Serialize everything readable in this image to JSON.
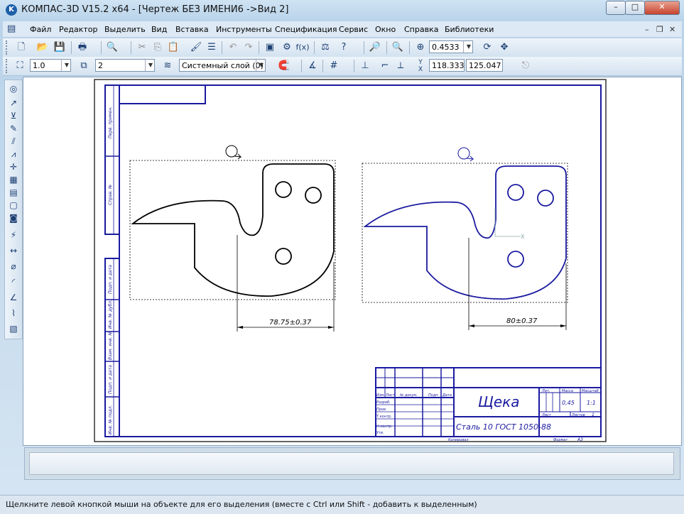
{
  "window": {
    "title": "КОМПАС-3D V15.2  x64 - [Чертеж БЕЗ ИМЕНИ6 ->Вид 2]",
    "minimize_label": "–",
    "maximize_label": "□",
    "close_label": "✕"
  },
  "menu": {
    "items": [
      "Файл",
      "Редактор",
      "Выделить",
      "Вид",
      "Вставка",
      "Инструменты",
      "Спецификация",
      "Сервис",
      "Окно",
      "Справка",
      "Библиотеки"
    ]
  },
  "toolbar": {
    "zoom_value": "0.4533"
  },
  "properties_bar": {
    "line_scale": "1.0",
    "view_number": "2",
    "layer": "Системный слой (0)",
    "coord_x": "118.333",
    "coord_y": "125.047"
  },
  "drawing": {
    "dimension_left": "78.75±0.37",
    "dimension_right": "80±0.37",
    "title_block": {
      "part_name": "Щека",
      "material": "Сталь 10  ГОСТ 1050-88",
      "mass": "0,45",
      "scale": "1:1",
      "sheet_label": "Лист",
      "sheets_label": "Листов",
      "sheets_count": "1",
      "lit_label": "Лит.",
      "mass_label": "Масса",
      "scale_label": "Масштаб",
      "change_label": "Изм.",
      "sheet_col_label": "Лист",
      "doc_num_label": "№ докум.",
      "sign_label": "Подп.",
      "date_label": "Дата",
      "developed_label": "Разраб.",
      "checked_label": "Пров.",
      "tech_label": "Т.контр.",
      "norm_label": "Н.контр.",
      "approved_label": "Утв.",
      "copied_label": "Копировал",
      "format_label": "Формат",
      "format_value": "А3"
    },
    "side_labels": [
      "Перв. примен.",
      "Справ. №",
      "Подп. и дата",
      "Инв. № дубл.",
      "Взам. инв. №",
      "Подп. и дата",
      "Инв. № подл."
    ]
  },
  "status_bar": {
    "message": "Щелкните левой кнопкой мыши на объекте для его выделения (вместе с Ctrl или Shift - добавить к выделенным)"
  },
  "colors": {
    "frame": "#1a1aa0",
    "geometry_selected": "#1a1aa0",
    "geometry": "#000000"
  }
}
